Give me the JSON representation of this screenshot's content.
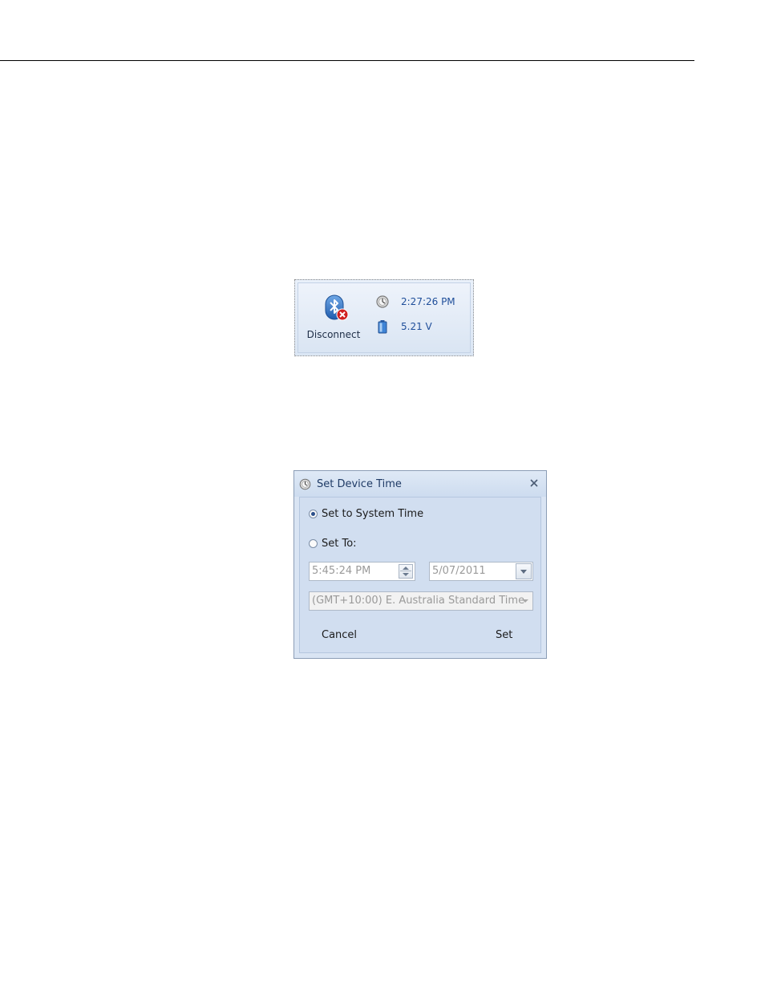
{
  "ribbon": {
    "disconnect_label": "Disconnect",
    "device_time": "2:27:26 PM",
    "battery_voltage": "5.21 V"
  },
  "dialog": {
    "title": "Set Device Time",
    "option_system_time": "Set to System Time",
    "option_set_to": "Set To:",
    "selected_option": "Set to System Time",
    "time_value": "5:45:24 PM",
    "date_value": "5/07/2011",
    "timezone_value": "(GMT+10:00) E. Australia Standard Time",
    "cancel_label": "Cancel",
    "set_label": "Set"
  },
  "icons": {
    "ribbon": [
      "bluetooth-icon",
      "disconnect-x-icon",
      "clock-icon",
      "battery-icon"
    ],
    "dialog": [
      "clock-icon",
      "close-icon",
      "spin-up-icon",
      "spin-down-icon",
      "dropdown-arrow-icon"
    ]
  },
  "colors": {
    "bluetooth_blue": "#2f6fc2",
    "error_red": "#d02020",
    "value_text": "#1f4e9a",
    "dialog_background": "#d1def0"
  }
}
